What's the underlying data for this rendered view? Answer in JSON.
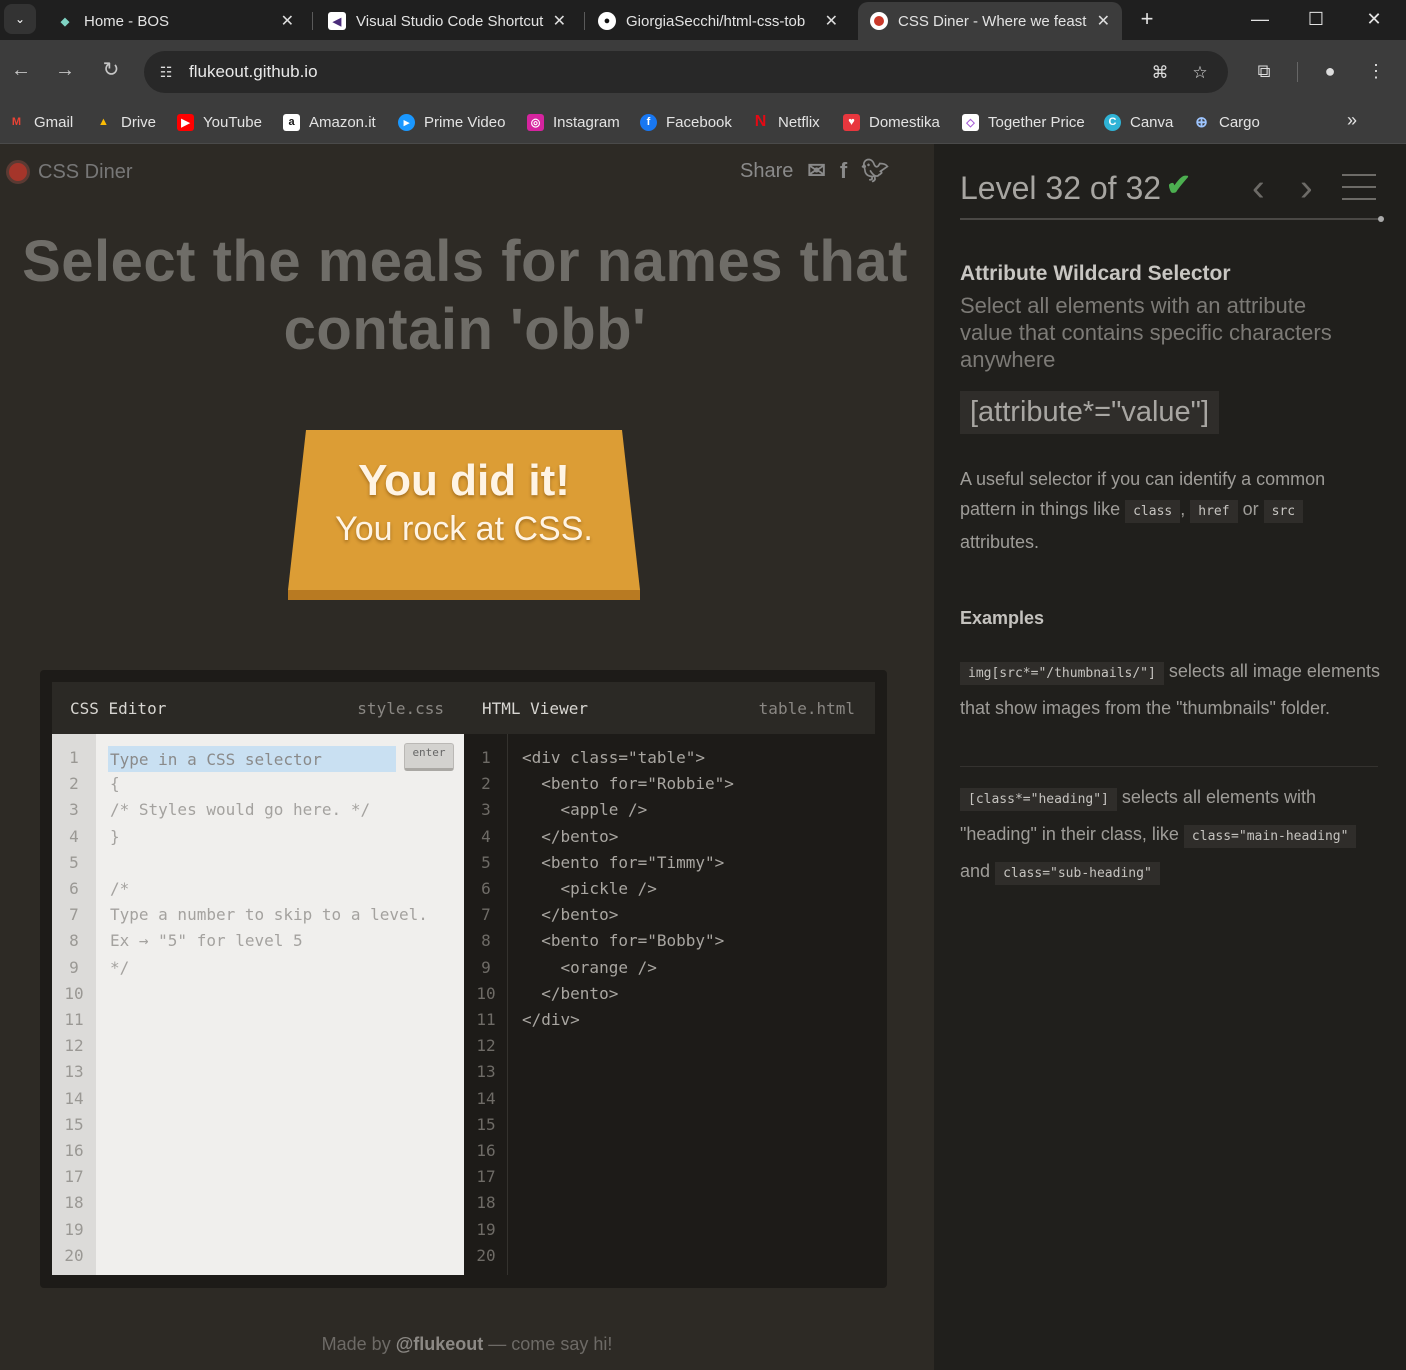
{
  "browser": {
    "tabs": [
      {
        "title": "Home - BOS",
        "favicon": "bos-icon"
      },
      {
        "title": "Visual Studio Code Shortcut",
        "favicon": "vscode-icon"
      },
      {
        "title": "GiorgiaSecchi/html-css-tob",
        "favicon": "github-icon"
      },
      {
        "title": "CSS Diner - Where we feast",
        "favicon": "css-diner-icon",
        "active": true
      }
    ],
    "url": "flukeout.github.io",
    "bookmarks": [
      "Gmail",
      "Drive",
      "YouTube",
      "Amazon.it",
      "Prime Video",
      "Instagram",
      "Facebook",
      "Netflix",
      "Domestika",
      "Together Price",
      "Canva",
      "Cargo"
    ]
  },
  "app": {
    "logo_text": "CSS Diner",
    "share_label": "Share",
    "instruction": "Select the meals for names that contain 'obb'",
    "table_message": {
      "line1": "You did it!",
      "line2": "You rock at CSS."
    },
    "footer": {
      "prefix": "Made by",
      "author": "@flukeout",
      "suffix": "— come say hi!"
    }
  },
  "css_editor": {
    "title": "CSS Editor",
    "filename": "style.css",
    "input_placeholder": "Type in a CSS selector",
    "enter_label": "enter",
    "line_numbers": [
      "1",
      "2",
      "3",
      "4",
      "5",
      "6",
      "7",
      "8",
      "9",
      "10",
      "11",
      "12",
      "13",
      "14",
      "15",
      "16",
      "17",
      "18",
      "19",
      "20"
    ],
    "lines": [
      "{",
      "/* Styles would go here. */",
      "}",
      "",
      "/*",
      "Type a number to skip to a level.",
      "Ex → \"5\" for level 5",
      "*/"
    ]
  },
  "html_viewer": {
    "title": "HTML Viewer",
    "filename": "table.html",
    "line_numbers": [
      "1",
      "2",
      "3",
      "4",
      "5",
      "6",
      "7",
      "8",
      "9",
      "10",
      "11",
      "12",
      "13",
      "14",
      "15",
      "16",
      "17",
      "18",
      "19",
      "20"
    ],
    "lines": [
      "<div class=\"table\">",
      "  <bento for=\"Robbie\">",
      "    <apple />",
      "  </bento>",
      "  <bento for=\"Timmy\">",
      "    <pickle />",
      "  </bento>",
      "  <bento for=\"Bobby\">",
      "    <orange />",
      "  </bento>",
      "</div>"
    ]
  },
  "sidebar": {
    "level_title": "Level 32 of 32",
    "level_complete": true,
    "progress_fraction": 1.0,
    "selector_name": "Attribute Wildcard Selector",
    "selector_description": "Select all elements with an attribute value that contains specific characters anywhere",
    "syntax": "[attribute*=\"value\"]",
    "hint": {
      "prefix": "A useful selector if you can identify a common pattern in things like",
      "code1": "class",
      "sep": ",",
      "code2": "href",
      "or": "or",
      "code3": "src",
      "suffix": "attributes."
    },
    "examples_heading": "Examples",
    "examples": [
      {
        "code": "img[src*=\"/thumbnails/\"]",
        "text": "selects all image elements that show images from the \"thumbnails\" folder."
      },
      {
        "code": "[class*=\"heading\"]",
        "text": "selects all elements with \"heading\" in their class, like",
        "code2": "class=\"main-heading\"",
        "and": "and",
        "code3": "class=\"sub-heading\""
      }
    ]
  },
  "colors": {
    "accent_table": "#e0a23a",
    "check": "#4caf50",
    "logo_red": "#a5352a"
  }
}
